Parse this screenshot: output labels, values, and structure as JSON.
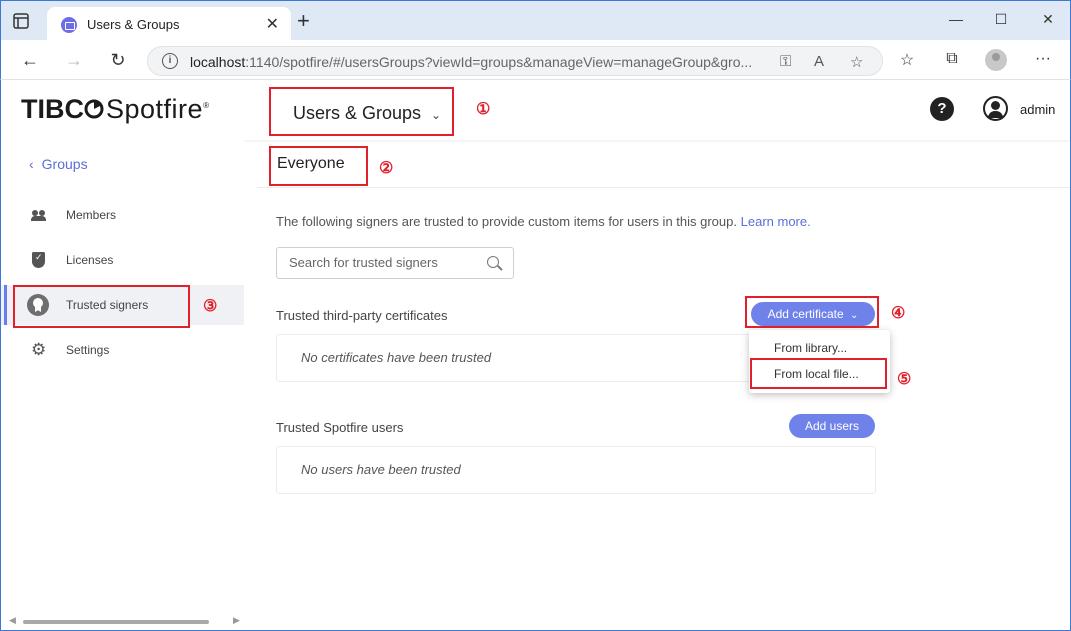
{
  "browser": {
    "tab_title": "Users & Groups",
    "tab_close": "✕",
    "new_tab": "+",
    "url_host": "localhost",
    "url_rest": ":1140/spotfire/#/usersGroups?viewId=groups&manageView=manageGroup&gro..."
  },
  "header": {
    "logo_tibco": "TIBC",
    "logo_spotfire": "Spotfire",
    "page_switcher": "Users & Groups",
    "help": "?",
    "username": "admin"
  },
  "sidebar": {
    "back_label": "Groups",
    "items": [
      {
        "label": "Members",
        "icon": "people-icon"
      },
      {
        "label": "Licenses",
        "icon": "shield-icon"
      },
      {
        "label": "Trusted signers",
        "icon": "badge-icon"
      },
      {
        "label": "Settings",
        "icon": "gear-icon"
      }
    ]
  },
  "main": {
    "group_name": "Everyone",
    "description": "The following signers are trusted to provide custom items for users in this group.",
    "learn_more": "Learn more.",
    "search_placeholder": "Search for trusted signers",
    "certificates": {
      "label": "Trusted third-party certificates",
      "button": "Add certificate",
      "empty": "No certificates have been trusted",
      "menu": [
        "From library...",
        "From local file..."
      ]
    },
    "users": {
      "label": "Trusted Spotfire users",
      "button": "Add users",
      "empty": "No users have been trusted"
    }
  },
  "annotations": [
    "①",
    "②",
    "③",
    "④",
    "⑤"
  ],
  "colors": {
    "accent": "#6f82ea",
    "link": "#5b6fd6",
    "annotation": "#e0202a"
  }
}
